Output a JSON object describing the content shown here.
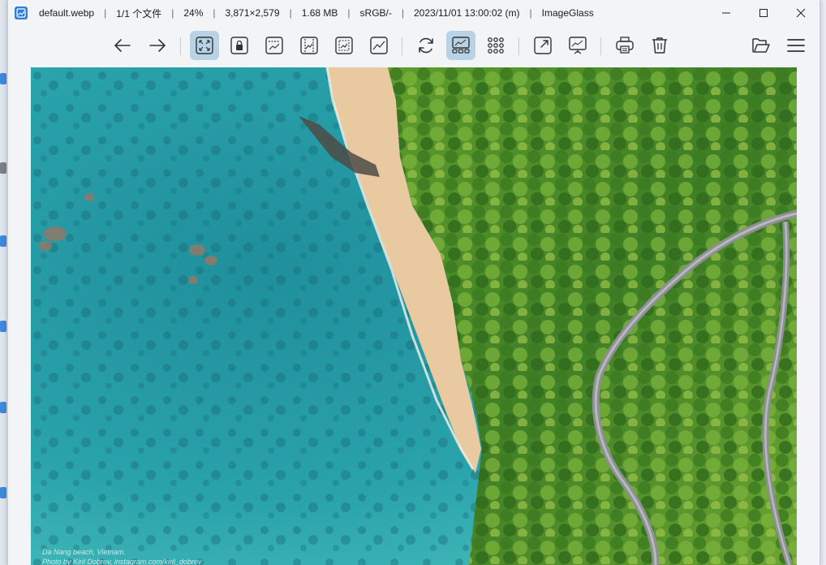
{
  "window": {
    "title_segments": [
      "default.webp",
      "1/1 个文件",
      "24%",
      "3,871×2,579",
      "1.68 MB",
      "sRGB/-",
      "2023/11/01 13:00:02 (m)",
      "ImageGlass"
    ]
  },
  "toolbar": {
    "buttons": [
      {
        "icon": "arrow-left-icon",
        "active": false
      },
      {
        "icon": "arrow-right-icon",
        "active": false
      },
      {
        "icon": "auto-zoom-icon",
        "active": true
      },
      {
        "icon": "lock-zoom-icon",
        "active": false
      },
      {
        "icon": "scale-to-width-icon",
        "active": false
      },
      {
        "icon": "scale-to-height-icon",
        "active": false
      },
      {
        "icon": "scale-to-fit-icon",
        "active": false
      },
      {
        "icon": "scale-to-fill-icon",
        "active": false
      },
      {
        "icon": "refresh-icon",
        "active": false
      },
      {
        "icon": "gallery-icon",
        "active": true
      },
      {
        "icon": "thumbnail-grid-icon",
        "active": false
      },
      {
        "icon": "fullscreen-icon",
        "active": false
      },
      {
        "icon": "slideshow-icon",
        "active": false
      },
      {
        "icon": "print-icon",
        "active": false
      },
      {
        "icon": "delete-icon",
        "active": false
      },
      {
        "icon": "open-folder-icon",
        "active": false
      },
      {
        "icon": "menu-icon",
        "active": false
      }
    ]
  },
  "image": {
    "caption_line1": "Da Nang beach, Vietnam.",
    "caption_line2": "Photo by Kiril Dobrev, instagram.com/kiril_dobrev"
  },
  "colors": {
    "accent": "#b9d3e6",
    "app_icon": "#2d7fd6",
    "sea": "#2aa0a8",
    "sand": "#e7c9a0",
    "forest": "#4f8f2a"
  }
}
